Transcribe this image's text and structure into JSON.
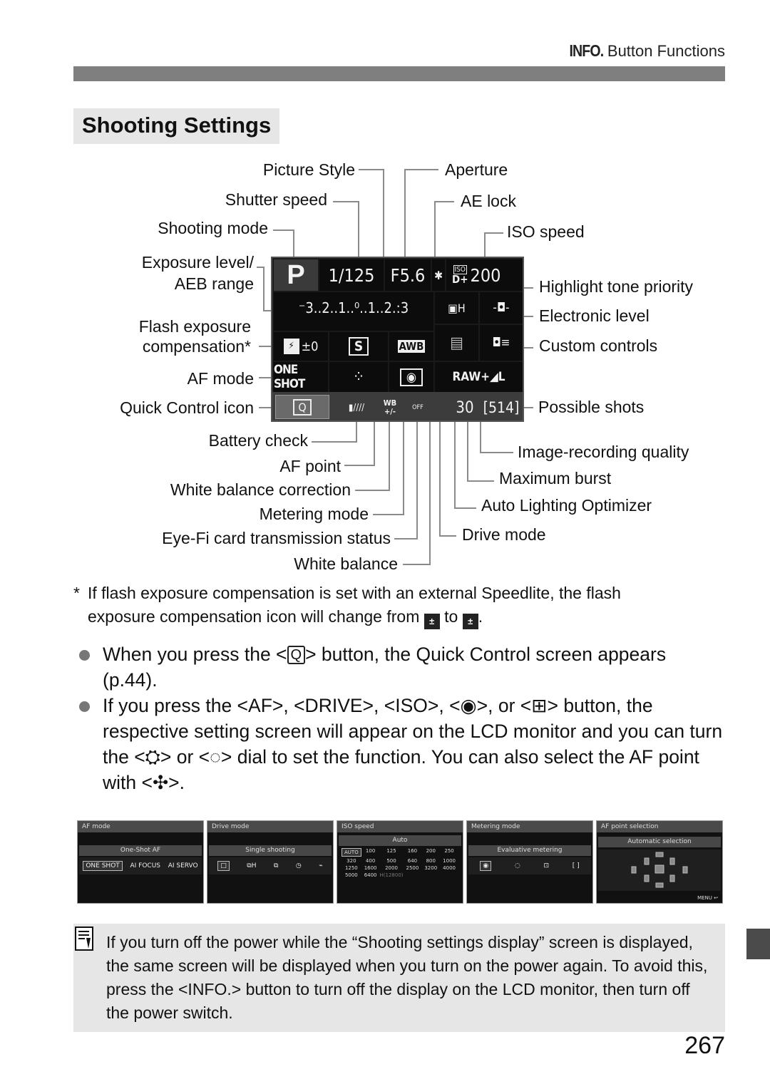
{
  "running_head": {
    "info_label": "INFO.",
    "title": "Button Functions"
  },
  "section_title": "Shooting Settings",
  "lcd": {
    "shooting_mode": "P",
    "shutter_speed": "1/125",
    "aperture": "F5.6",
    "ae_lock": "✱",
    "iso_label": "ISO",
    "iso_speed": "200",
    "htp": "D+",
    "exposure_scale": "⁻3..2..1..⁰..1..2.:3",
    "drive_mode": "▣H",
    "electronic_level": "-◘-",
    "flash_comp": "±0",
    "flash_icon": "⚡",
    "picture_style": "S",
    "white_balance": "AWB",
    "alo_icon": "▤",
    "custom_controls": "◘≡",
    "af_mode": "ONE SHOT",
    "af_point_icon": "⁘",
    "metering_icon": "◉",
    "quality": "RAW+◢L",
    "quick_control": "Q",
    "battery": "▮////",
    "wb_correction": "WB\n+/-",
    "eyefi": "OFF",
    "max_burst": "30",
    "possible_shots": "[514]"
  },
  "callouts": {
    "left": [
      "Picture Style",
      "Shutter speed",
      "Shooting mode",
      "Exposure level/",
      "AEB range",
      "Flash exposure",
      "compensation*",
      "AF mode",
      "Quick Control icon"
    ],
    "top_right": [
      "Aperture",
      "AE lock",
      "ISO speed"
    ],
    "right": [
      "Highlight tone priority",
      "Electronic level",
      "Custom controls",
      "Possible shots"
    ],
    "bottom_left": [
      "Battery check",
      "AF point",
      "White balance correction",
      "Metering mode",
      "Eye-Fi card transmission status",
      "White balance"
    ],
    "bottom_right": [
      "Image-recording quality",
      "Maximum burst",
      "Auto Lighting Optimizer",
      "Drive mode"
    ]
  },
  "footnote": {
    "star": "*",
    "line1": "If flash exposure compensation is set with an external Speedlite, the flash",
    "line2_a": "exposure compensation icon will change from",
    "icon_from": "±",
    "line2_b": "to",
    "icon_to": "±",
    "line2_c": "."
  },
  "bullets": [
    {
      "a": "When you press the <",
      "key": "Q",
      "b": "> button, the Quick Control screen appears (p.44)."
    },
    {
      "text": "If you press the <AF>, <DRIVE>, <ISO>, <◉>, or <⊞> button, the respective setting screen will appear on the LCD monitor and you can turn the <⛭> or <◌> dial to set the function. You can also select the AF point with <✣>."
    }
  ],
  "thumbnails": [
    {
      "header": "AF mode",
      "bar": "One-Shot AF",
      "options": [
        "ONE SHOT",
        "AI FOCUS",
        "AI SERVO"
      ]
    },
    {
      "header": "Drive mode",
      "bar": "Single shooting",
      "options": [
        "□",
        "⧉H",
        "⧉",
        "◷",
        "⌁"
      ]
    },
    {
      "header": "ISO speed",
      "bar": "Auto",
      "iso_values": [
        "AUTO",
        "100",
        "125",
        "160",
        "200",
        "250",
        "320",
        "400",
        "500",
        "640",
        "800",
        "1000",
        "1250",
        "1600",
        "2000",
        "2500",
        "3200",
        "4000",
        "5000",
        "6400",
        "H(12800)"
      ]
    },
    {
      "header": "Metering mode",
      "bar": "Evaluative metering",
      "options": [
        "◉",
        "◌",
        "⊡",
        "[ ]"
      ]
    },
    {
      "header": "AF point selection",
      "bar": "Automatic selection",
      "footer": "MENU ↩"
    }
  ],
  "note": {
    "text": "If you turn off the power while the “Shooting settings display” screen is displayed, the same screen will be displayed when you turn on the power again. To avoid this, press the <INFO.> button to turn off the display on the LCD monitor, then turn off the power switch."
  },
  "page_number": "267"
}
